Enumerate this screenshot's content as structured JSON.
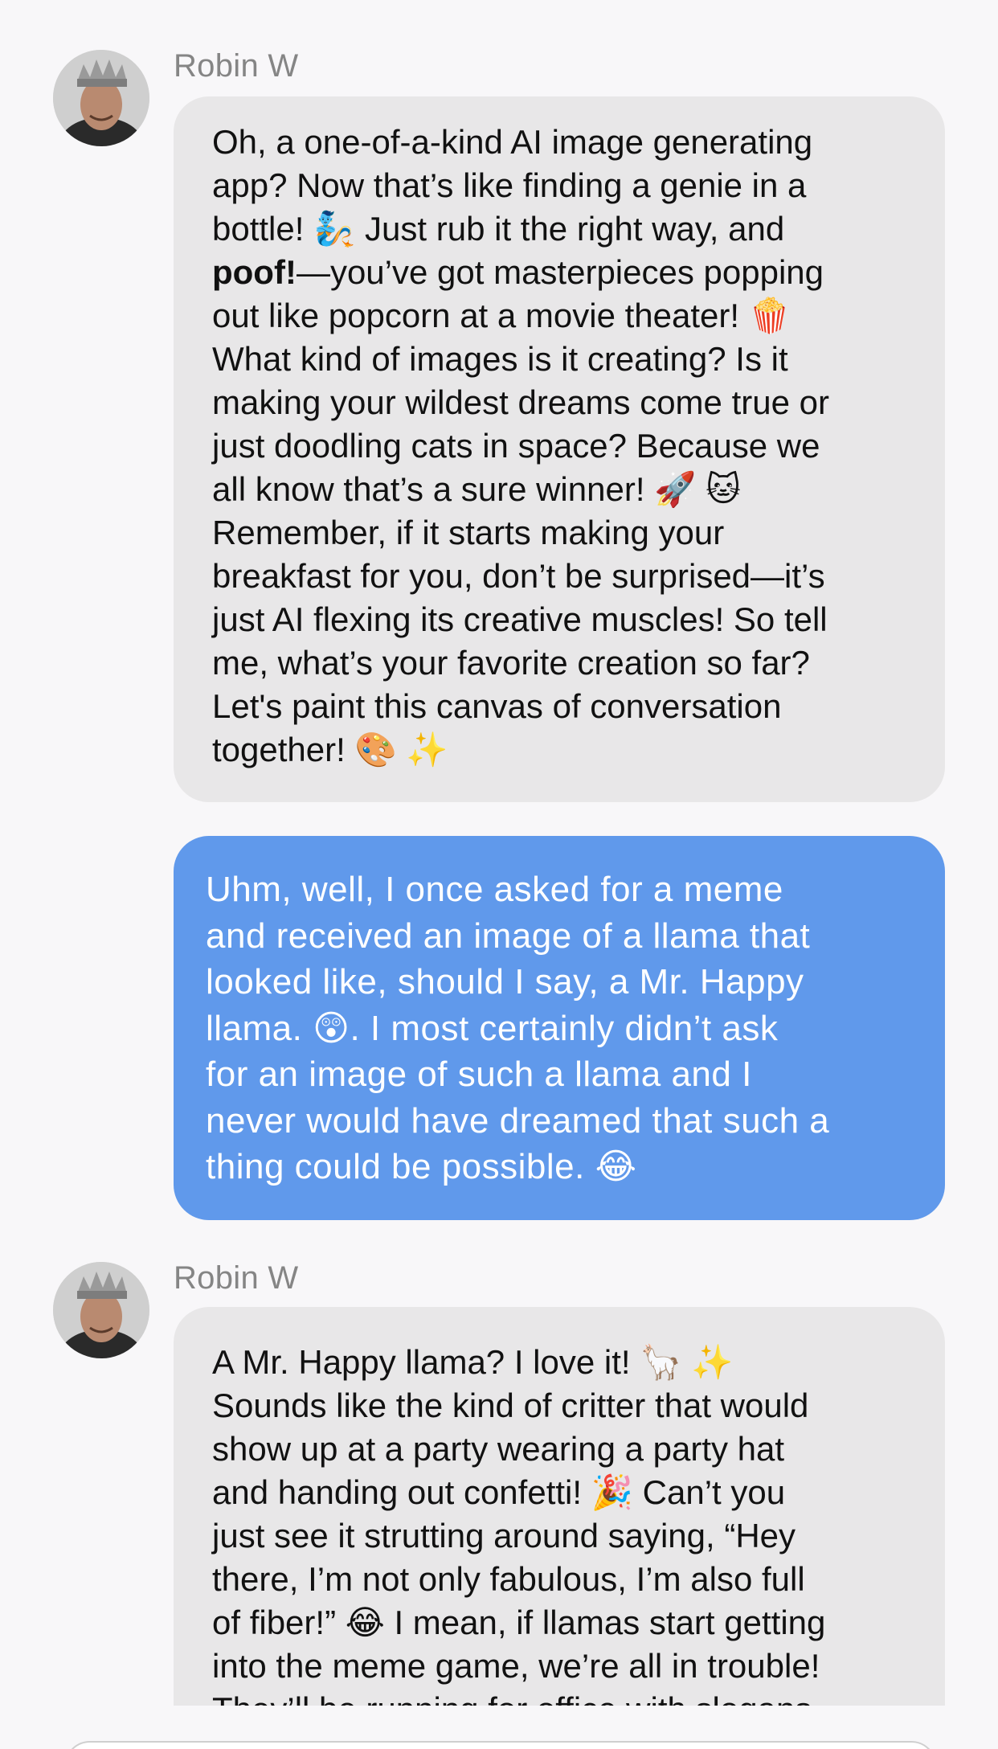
{
  "messages": [
    {
      "sender": "Robin W",
      "lines": [
        "Oh, a one-of-a-kind AI image generating",
        "app? Now that’s like finding a genie in a",
        "bottle! 🧞 Just rub it the right way, and",
        "—you’ve got masterpieces popping",
        "out like popcorn at a movie theater! 🍿",
        "What kind of images is it creating? Is it",
        "making your wildest dreams come true or",
        "just doodling cats in space? Because we",
        "all know that’s a sure winner! 🚀 🐱",
        "Remember, if it starts making your",
        "breakfast for you, don’t be surprised—it’s",
        "just AI flexing its creative muscles! So tell",
        "me, what’s your favorite creation so far?",
        "Let's paint this canvas of conversation",
        "together! 🎨 ✨"
      ],
      "bold_word": "poof!"
    },
    {
      "sender": "user",
      "lines": [
        "Uhm, well, I once asked for a meme",
        "and received an image of a llama that",
        "looked like, should I say, a Mr. Happy",
        "llama. 😲. I most certainly didn’t ask",
        "for an image of such a llama and I",
        "never would have dreamed that such a",
        "thing could be possible. 😂"
      ]
    },
    {
      "sender": "Robin W",
      "lines": [
        "A Mr. Happy llama? I love it! 🦙 ✨",
        "Sounds like the kind of critter that would",
        "show up at a party wearing a party hat",
        "and handing out confetti! 🎉 Can’t you",
        "just see it strutting around saying, “Hey",
        "there, I’m not only fabulous, I’m also full",
        "of fiber!” 😂 I mean, if llamas start getting",
        "into the meme game, we’re all in trouble!",
        "They’ll be running for office with slogans"
      ]
    }
  ]
}
